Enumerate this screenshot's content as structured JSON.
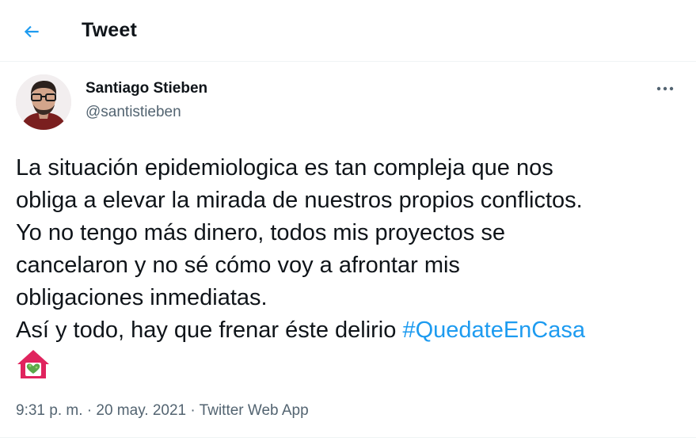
{
  "header": {
    "back_icon": "arrow-left-icon",
    "title": "Tweet"
  },
  "author": {
    "name": "Santiago Stieben",
    "handle": "@santistieben",
    "avatar_icon": "profile-photo"
  },
  "more_icon": "ellipsis-icon",
  "tweet": {
    "lines": [
      "La situación epidemiologica es tan compleja que nos",
      "obliga a elevar la mirada de nuestros propios conflictos.",
      "Yo no tengo más dinero, todos mis proyectos se",
      "cancelaron y no sé cómo voy a afrontar mis",
      "obligaciones inmediatas."
    ],
    "last_line_text": "Así y todo, hay que frenar éste delirio ",
    "hashtag": "#QuedateEnCasa",
    "emoji_icon": "house-with-heart-emoji"
  },
  "meta": {
    "time": "9:31 p. m.",
    "separator": " · ",
    "date": "20 may. 2021",
    "source": "Twitter Web App"
  },
  "colors": {
    "accent": "#1d9bf0",
    "text": "#0f1419",
    "secondary": "#536471",
    "border": "#eff3f4"
  }
}
